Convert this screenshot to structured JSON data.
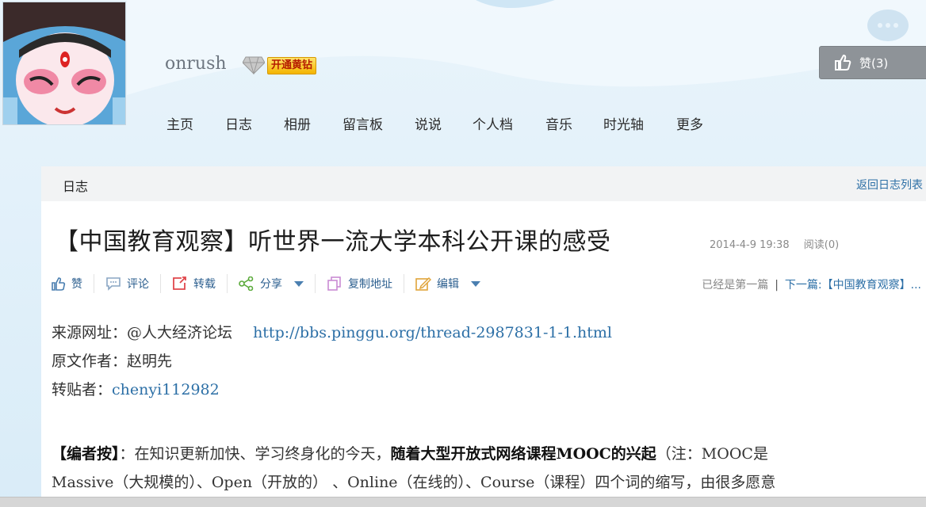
{
  "header": {
    "username": "onrush",
    "vip_badge": "开通黄钻",
    "like_button": "赞(3)"
  },
  "nav": [
    "主页",
    "日志",
    "相册",
    "留言板",
    "说说",
    "个人档",
    "音乐",
    "时光轴",
    "更多"
  ],
  "panel": {
    "title": "日志",
    "back_link": "返回日志列表"
  },
  "post": {
    "title": "【中国教育观察】听世界一流大学本科公开课的感受",
    "date": "2014-4-9 19:38",
    "reads": "阅读(0)"
  },
  "toolbar": {
    "like": "赞",
    "comment": "评论",
    "repost": "转载",
    "share": "分享",
    "copy_url": "复制地址",
    "edit": "编辑"
  },
  "pager": {
    "first": "已经是第一篇",
    "separator": "|",
    "next": "下一篇:【中国教育观察】..."
  },
  "content": {
    "source_label": "来源网址：@人大经济论坛",
    "source_url": "http://bbs.pinggu.org/thread-2987831-1-1.html",
    "author": "原文作者：赵明先",
    "reposter_label": "转贴者：",
    "reposter": "chenyi112982",
    "note_label": "【编者按】",
    "note_part1": "：在知识更新加快、学习终身化的今天，",
    "note_bold": "随着大型开放式网络课程MOOC的兴起",
    "note_part2": "（注：MOOC是",
    "note_line2": "Massive（大规模的）、Open（开放的） 、Online（在线的）、Course（课程）四个词的缩写，由很多愿意"
  }
}
